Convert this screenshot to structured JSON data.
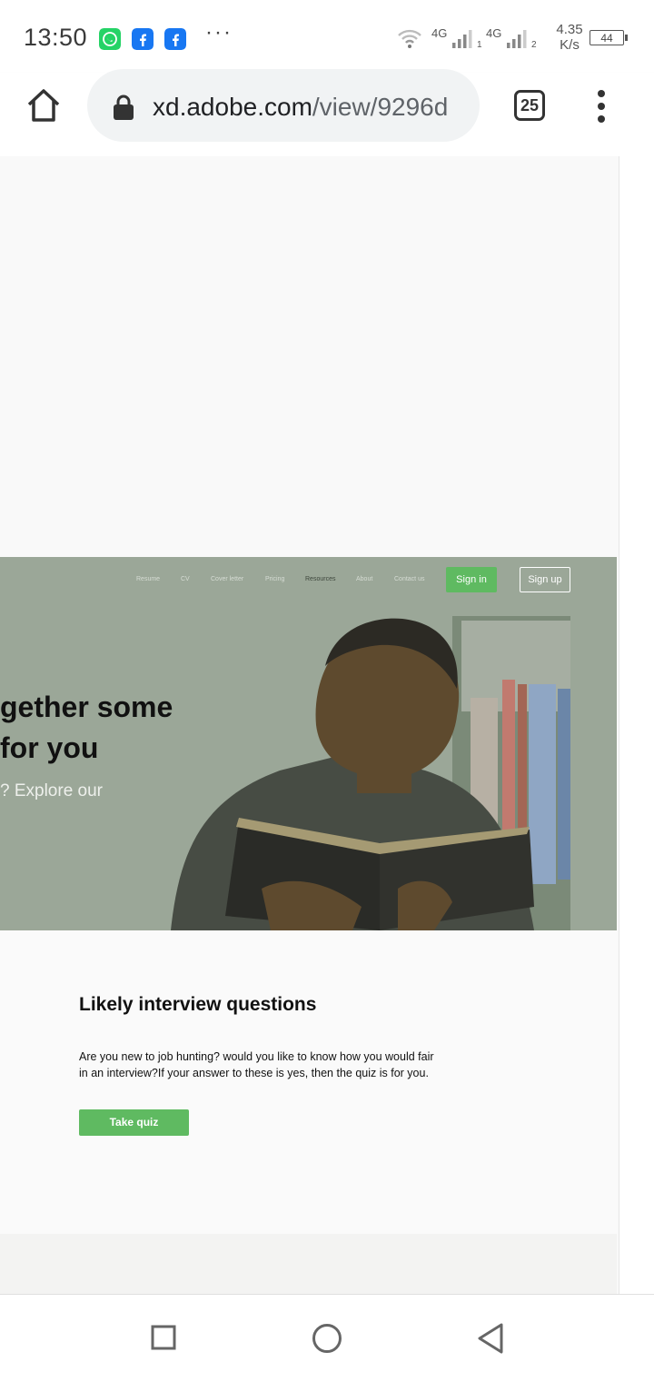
{
  "status_bar": {
    "time": "13:50",
    "notification_icons": [
      "whatsapp-icon",
      "facebook-icon",
      "facebook-icon"
    ],
    "more": "···",
    "network1": "4G",
    "sim1": "1",
    "network2": "4G",
    "sim2": "2",
    "speed_value": "4.35",
    "speed_unit": "K/s",
    "battery": "44"
  },
  "browser": {
    "url_host": "xd.adobe.com",
    "url_path": "/view/9296d",
    "tab_count": "25"
  },
  "hero": {
    "nav_items": [
      "Resume",
      "CV",
      "Cover letter",
      "Pricing",
      "Resources",
      "About",
      "Contact us"
    ],
    "signin_label": "Sign in",
    "signup_label": "Sign up",
    "headline_line1": "gether some",
    "headline_line2": "for you",
    "subtext": "? Explore our"
  },
  "section": {
    "title": "Likely interview questions",
    "body": "Are you new to job hunting? would you like to know how you would fair in an interview?If your answer to these is yes, then the quiz is for you.",
    "button_label": "Take quiz"
  },
  "colors": {
    "accent_green": "#5fba61",
    "hero_overlay": "#9ba798"
  }
}
